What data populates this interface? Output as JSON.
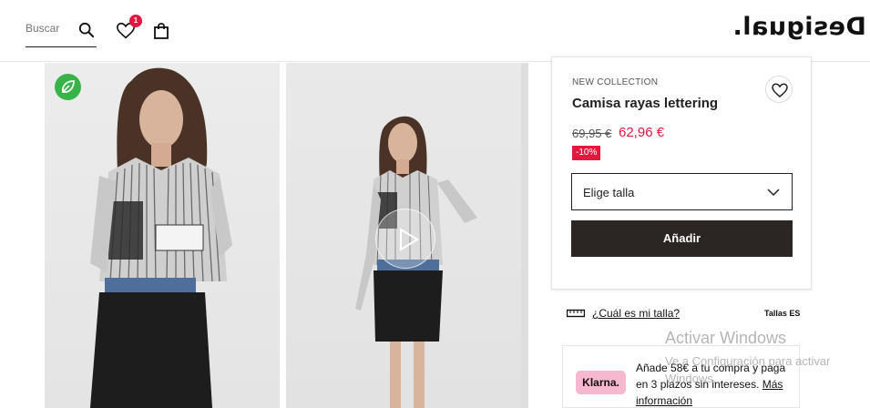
{
  "header": {
    "search_placeholder": "Buscar",
    "wishlist_count": "1",
    "logo": "Desigual."
  },
  "product": {
    "collection": "NEW COLLECTION",
    "title": "Camisa rayas lettering",
    "old_price": "69,95 €",
    "new_price": "62,96 €",
    "discount": "-10%",
    "size_select": "Elige talla",
    "add_button": "Añadir"
  },
  "size_guide": {
    "link": "¿Cuál es mi talla?",
    "sizes_region": "Tallas ES"
  },
  "klarna": {
    "logo": "Klarna.",
    "text": "Añade 58€ a tu compra y paga en 3 plazos sin intereses.",
    "link": "Más información"
  },
  "watermark": {
    "title": "Activar Windows",
    "subtitle": "Ve a Configuración para activar Windows."
  },
  "colors": {
    "accent_red": "#e5173f",
    "button_dark": "#2b2623",
    "eco_green": "#37b34a",
    "klarna_pink": "#f6b8cf"
  },
  "icons": [
    "search-icon",
    "heart-icon",
    "shopping-bag-icon",
    "leaf-icon",
    "play-icon",
    "chevron-down-icon",
    "ruler-icon"
  ]
}
